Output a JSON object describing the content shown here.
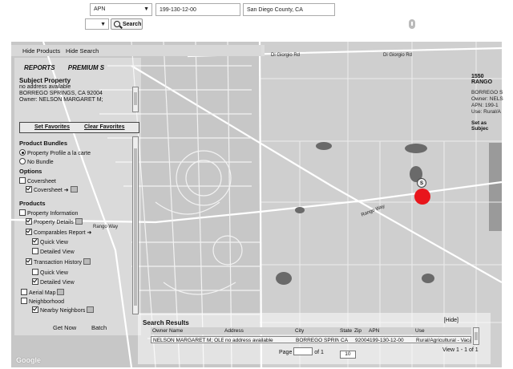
{
  "search": {
    "type_value": "APN",
    "apn_value": "199-130-12-00",
    "county_value": "San Diego County, CA",
    "search_label": "Search"
  },
  "panel_header": {
    "hide_products": "Hide Products",
    "hide_search": "Hide Search"
  },
  "tabs": {
    "reports": "REPORTS",
    "premium": "PREMIUM S"
  },
  "subject": {
    "title": "Subject Property",
    "line1": "no address available",
    "line2": "BORREGO SPRINGS, CA 92004",
    "line3": "Owner: NELSON MARGARET M;"
  },
  "favorites": {
    "set": "Set Favorites",
    "clear": "Clear Favorites"
  },
  "products": {
    "bundles_title": "Product Bundles",
    "bundle_profile": "Property Profile a la carte",
    "no_bundle": "No Bundle",
    "options_title": "Options",
    "coversheet_option": "Coversheet",
    "coversheet": "Coversheet",
    "products_title": "Products",
    "property_info": "Property Information",
    "property_details": "Property Details",
    "comparables": "Comparables Report",
    "quick_view_1": "Quick View",
    "detailed_view_1": "Detailed View",
    "transaction_history": "Transaction History",
    "quick_view_2": "Quick View",
    "detailed_view_2": "Detailed View",
    "aerial_map": "Aerial Map",
    "neighborhood": "Neighborhood",
    "nearby_neighbors": "Nearby Neighbors",
    "get_now": "Get Now",
    "batch": "Batch"
  },
  "results": {
    "title": "Search Results",
    "hide": "[Hide]",
    "columns": [
      "Owner Name",
      "Address",
      "City",
      "State",
      "Zip",
      "APN",
      "Use"
    ],
    "row": [
      "NELSON MARGARET M; OLENI",
      "no address available",
      "BORREGO SPRINGS",
      "CA",
      "92004",
      "199-130-12-00",
      "Rural/Agricultural - Vacant"
    ],
    "page_label": "Page",
    "of_label": "of 1",
    "page_size": "10",
    "view_count": "View 1 - 1 of 1"
  },
  "right_panel": {
    "address": "1550 RANGO",
    "line1": "BORREGO S",
    "line2": "Owner: NELS",
    "line3": "APN: 199-1",
    "line4": "Use: Rural/A",
    "set_subject": "Set as Subjec"
  },
  "map": {
    "marker_label": "S",
    "street_rango": "Rango Way",
    "street_rango_2": "Rango Way",
    "street_di_gorgio_1": "Di Giorgio Rd",
    "street_di_gorgio_2": "Di Giorgio Rd",
    "google": "Google"
  }
}
